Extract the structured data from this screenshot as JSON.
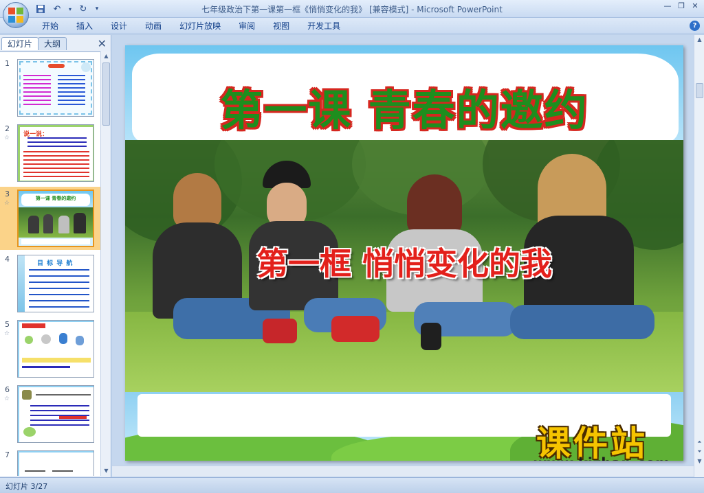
{
  "window": {
    "title": "七年级政治下第一课第一框《悄悄变化的我》 [兼容模式] - Microsoft PowerPoint"
  },
  "ribbon": {
    "tabs": [
      "开始",
      "插入",
      "设计",
      "动画",
      "幻灯片放映",
      "审阅",
      "视图",
      "开发工具"
    ]
  },
  "left_pane": {
    "tabs": [
      "幻灯片",
      "大纲"
    ],
    "slides": [
      {
        "number": "1",
        "star": ""
      },
      {
        "number": "2",
        "star": "☆"
      },
      {
        "number": "3",
        "star": "☆"
      },
      {
        "number": "4",
        "star": ""
      },
      {
        "number": "5",
        "star": "☆"
      },
      {
        "number": "6",
        "star": "☆"
      },
      {
        "number": "7",
        "star": ""
      }
    ],
    "thumb_texts": {
      "s2_heading": "说一说：",
      "s4_heading": "目 标 导 航",
      "s3_title": "第一课 青春的邀约"
    }
  },
  "slide": {
    "title_main": "第一课  青春的邀约",
    "title_sub": "第一框  悄悄变化的我",
    "watermark_name": "课件站",
    "watermark_url": "www.kjzhan.com"
  },
  "status": {
    "slide_info": "幻灯片 3/27"
  },
  "colors": {
    "title_green": "#1e8e1e",
    "title_outline_red": "#d6271f",
    "subtitle_red": "#e3201b",
    "watermark_yellow": "#f6c400",
    "selection_orange": "#fbd389"
  }
}
